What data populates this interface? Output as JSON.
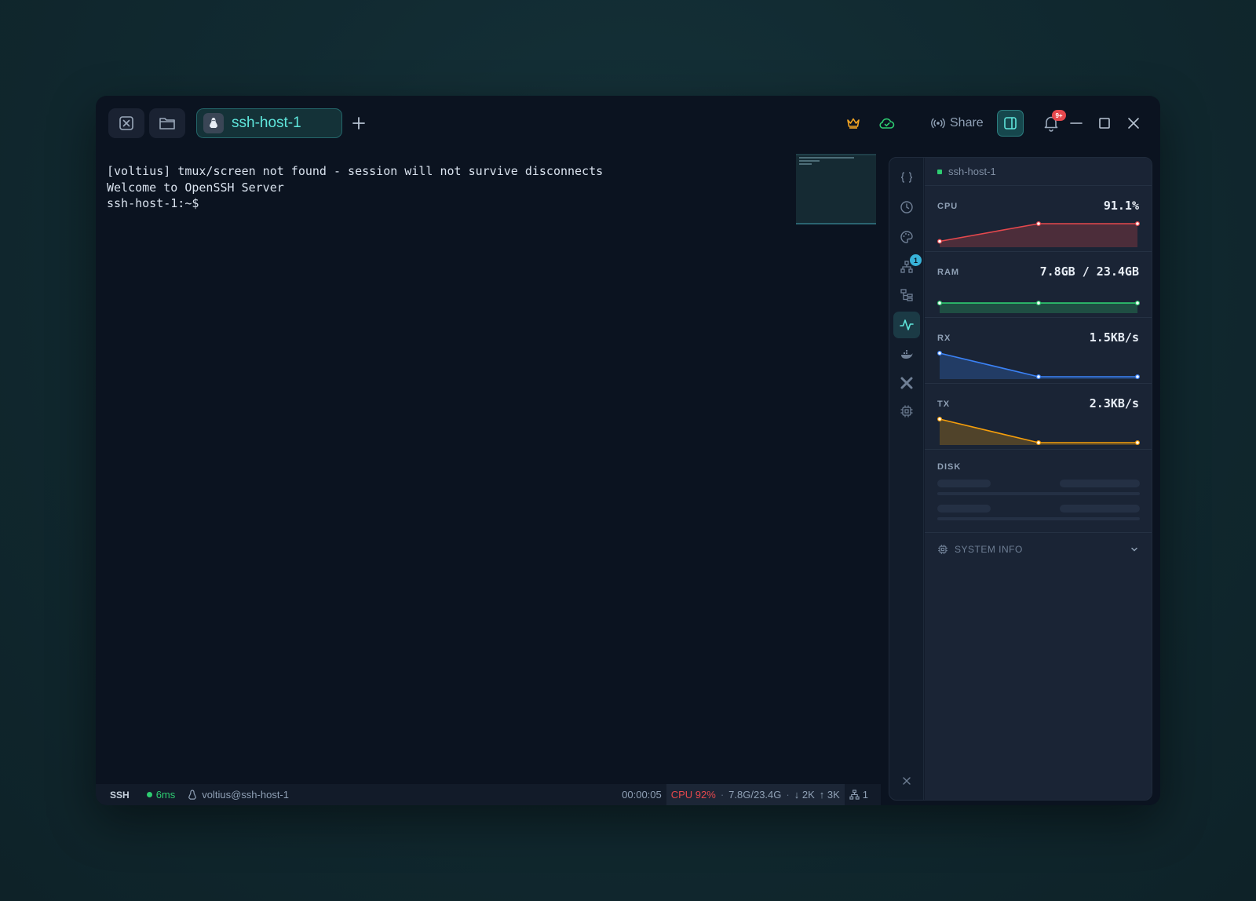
{
  "titlebar": {
    "tab": {
      "label": "ssh-host-1",
      "icon": "linux-icon"
    },
    "share_label": "Share",
    "notifications_badge": "9+"
  },
  "terminal": {
    "lines": [
      "[voltius] tmux/screen not found - session will not survive disconnects",
      "Welcome to OpenSSH Server",
      "ssh-host-1:~$"
    ]
  },
  "statusbar": {
    "protocol": "SSH",
    "latency": "6ms",
    "user_host": "voltius@ssh-host-1",
    "uptime": "00:00:05",
    "cpu": "CPU 92%",
    "mem": "7.8G/23.4G",
    "rx": "↓ 2K",
    "tx": "↑ 3K",
    "connections": "1"
  },
  "sidepanel": {
    "rail_badge": "1",
    "host": "ssh-host-1",
    "metrics": {
      "cpu": {
        "label": "CPU",
        "value": "91.1%",
        "color": "#e5484d",
        "points": [
          0.15,
          0.9,
          0.9
        ]
      },
      "ram": {
        "label": "RAM",
        "value": "7.8GB / 23.4GB",
        "color": "#2ecc71",
        "points": [
          0.33,
          0.33,
          0.33
        ]
      },
      "rx": {
        "label": "RX",
        "value": "1.5KB/s",
        "color": "#3b82f6",
        "points": [
          1.0,
          0.0,
          0.0
        ]
      },
      "tx": {
        "label": "TX",
        "value": "2.3KB/s",
        "color": "#f59e0b",
        "points": [
          1.0,
          0.0,
          0.0
        ]
      }
    },
    "disk_label": "DISK",
    "system_info_label": "SYSTEM INFO"
  }
}
